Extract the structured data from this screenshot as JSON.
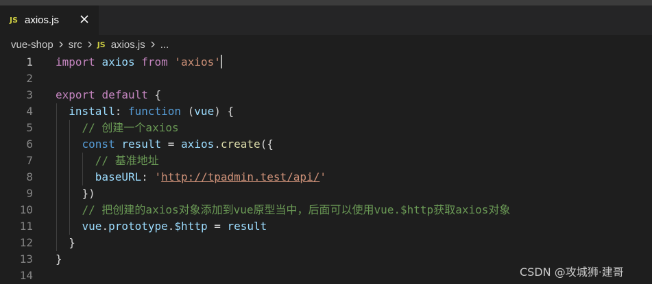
{
  "tab": {
    "badge": "JS",
    "filename": "axios.js",
    "close_icon": "close-icon"
  },
  "breadcrumb": {
    "project": "vue-shop",
    "folder": "src",
    "badge": "JS",
    "file": "axios.js",
    "more": "..."
  },
  "editor": {
    "lines": [
      {
        "num": "1",
        "tokens": [
          {
            "t": "import",
            "c": "kwc"
          },
          {
            "t": " ",
            "c": "pu"
          },
          {
            "t": "axios",
            "c": "var"
          },
          {
            "t": " ",
            "c": "pu"
          },
          {
            "t": "from",
            "c": "kwc"
          },
          {
            "t": " ",
            "c": "pu"
          },
          {
            "t": "'axios'",
            "c": "str"
          }
        ]
      },
      {
        "num": "2",
        "tokens": []
      },
      {
        "num": "3",
        "tokens": [
          {
            "t": "export",
            "c": "kwc"
          },
          {
            "t": " ",
            "c": "pu"
          },
          {
            "t": "default",
            "c": "kwc"
          },
          {
            "t": " {",
            "c": "pu"
          }
        ]
      },
      {
        "num": "4",
        "tokens": [
          {
            "t": "  ",
            "c": "pu"
          },
          {
            "t": "install",
            "c": "var"
          },
          {
            "t": ": ",
            "c": "pu"
          },
          {
            "t": "function",
            "c": "kw"
          },
          {
            "t": " (",
            "c": "pu"
          },
          {
            "t": "vue",
            "c": "var"
          },
          {
            "t": ") {",
            "c": "pu"
          }
        ]
      },
      {
        "num": "5",
        "tokens": [
          {
            "t": "    ",
            "c": "pu"
          },
          {
            "t": "// 创建一个axios",
            "c": "cm"
          }
        ]
      },
      {
        "num": "6",
        "tokens": [
          {
            "t": "    ",
            "c": "pu"
          },
          {
            "t": "const",
            "c": "kw"
          },
          {
            "t": " ",
            "c": "pu"
          },
          {
            "t": "result",
            "c": "var"
          },
          {
            "t": " = ",
            "c": "pu"
          },
          {
            "t": "axios",
            "c": "var"
          },
          {
            "t": ".",
            "c": "pu"
          },
          {
            "t": "create",
            "c": "fn"
          },
          {
            "t": "({",
            "c": "pu"
          }
        ]
      },
      {
        "num": "7",
        "tokens": [
          {
            "t": "      ",
            "c": "pu"
          },
          {
            "t": "// 基准地址",
            "c": "cm"
          }
        ]
      },
      {
        "num": "8",
        "tokens": [
          {
            "t": "      ",
            "c": "pu"
          },
          {
            "t": "baseURL",
            "c": "var"
          },
          {
            "t": ": ",
            "c": "pu"
          },
          {
            "t": "'",
            "c": "str"
          },
          {
            "t": "http://tpadmin.test/api/",
            "c": "link"
          },
          {
            "t": "'",
            "c": "str"
          }
        ]
      },
      {
        "num": "9",
        "tokens": [
          {
            "t": "    ",
            "c": "pu"
          },
          {
            "t": "})",
            "c": "pu"
          }
        ]
      },
      {
        "num": "10",
        "tokens": [
          {
            "t": "    ",
            "c": "pu"
          },
          {
            "t": "// 把创建的axios对象添加到vue原型当中，后面可以使用vue.$http获取axios对象",
            "c": "cm"
          }
        ]
      },
      {
        "num": "11",
        "tokens": [
          {
            "t": "    ",
            "c": "pu"
          },
          {
            "t": "vue",
            "c": "var"
          },
          {
            "t": ".",
            "c": "pu"
          },
          {
            "t": "prototype",
            "c": "var"
          },
          {
            "t": ".",
            "c": "pu"
          },
          {
            "t": "$http",
            "c": "var"
          },
          {
            "t": " = ",
            "c": "pu"
          },
          {
            "t": "result",
            "c": "var"
          }
        ]
      },
      {
        "num": "12",
        "tokens": [
          {
            "t": "  ",
            "c": "pu"
          },
          {
            "t": "}",
            "c": "pu"
          }
        ]
      },
      {
        "num": "13",
        "tokens": [
          {
            "t": "}",
            "c": "pu"
          }
        ]
      },
      {
        "num": "14",
        "tokens": []
      }
    ]
  },
  "watermark": "CSDN @攻城狮·建哥"
}
